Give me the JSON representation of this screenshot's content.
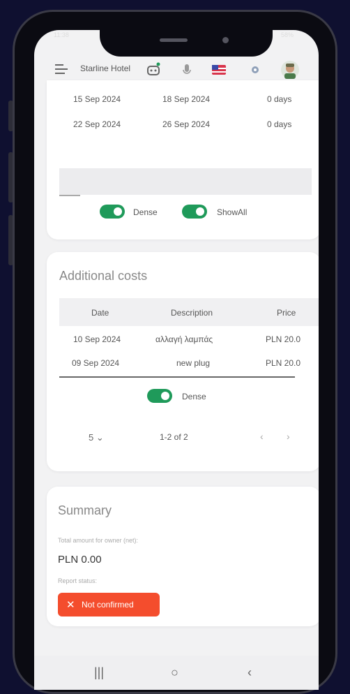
{
  "status_bar": {
    "time": "11:38",
    "battery": "58%"
  },
  "header": {
    "hotel_name": "Starline Hotel",
    "icons": [
      "menu-icon",
      "robot-icon",
      "microphone-icon",
      "us-flag-icon",
      "settings-icon",
      "avatar"
    ]
  },
  "reservations": {
    "rows": [
      {
        "from": "15 Sep 2024",
        "to": "18 Sep 2024",
        "days": "0 days"
      },
      {
        "from": "22 Sep 2024",
        "to": "26 Sep 2024",
        "days": "0 days"
      }
    ],
    "dense_label": "Dense",
    "show_all_label": "ShowAll"
  },
  "additional_costs": {
    "title": "Additional costs",
    "columns": [
      "Date",
      "Description",
      "Price"
    ],
    "rows": [
      {
        "date": "10 Sep 2024",
        "description": "αλλαγή λαμπάς",
        "price": "PLN 20.0"
      },
      {
        "date": "09 Sep 2024",
        "description": "new plug",
        "price": "PLN 20.0"
      }
    ],
    "dense_label": "Dense",
    "page_size": "5",
    "range": "1-2 of 2"
  },
  "summary": {
    "title": "Summary",
    "total_label": "Total amount for owner (net):",
    "total_value": "PLN 0.00",
    "report_status_label": "Report status:",
    "report_status": "Not confirmed",
    "status_color": "#f44d2d"
  },
  "colors": {
    "accent_green": "#1f9a5a",
    "background": "#0f1030"
  }
}
